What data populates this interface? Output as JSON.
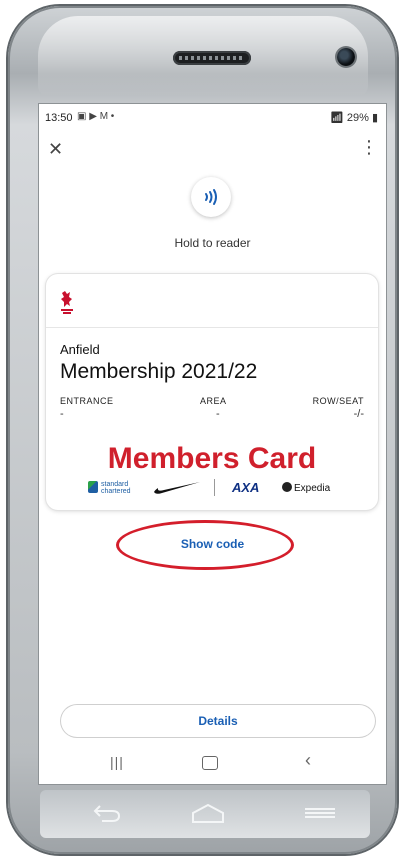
{
  "status_bar": {
    "time": "13:50",
    "left_icons": "▣ ▶ M •",
    "right_status": "29%"
  },
  "app_bar": {
    "close_icon": "close-icon",
    "more_icon": "more-vert-icon"
  },
  "nfc": {
    "icon": "contactless-icon",
    "label": "Hold to reader",
    "accent": "#1a5fb4"
  },
  "card": {
    "club_logo": "liverpool-fc-crest",
    "venue": "Anfield",
    "title": "Membership 2021/22",
    "columns": [
      {
        "label": "ENTRANCE",
        "value": "-"
      },
      {
        "label": "AREA",
        "value": "-"
      },
      {
        "label": "ROW/SEAT",
        "value": "-/-"
      }
    ],
    "banner_text": "Members Card",
    "banner_color": "#d0202c",
    "sponsors": {
      "standard_chartered": "standard chartered",
      "nike": "nike-swoosh",
      "axa": "AXA",
      "expedia": "Expedia"
    }
  },
  "show_code": {
    "label": "Show code"
  },
  "details": {
    "label": "Details"
  },
  "nav": {
    "recent": "recent-apps-icon",
    "home": "home-icon",
    "back": "back-icon"
  }
}
